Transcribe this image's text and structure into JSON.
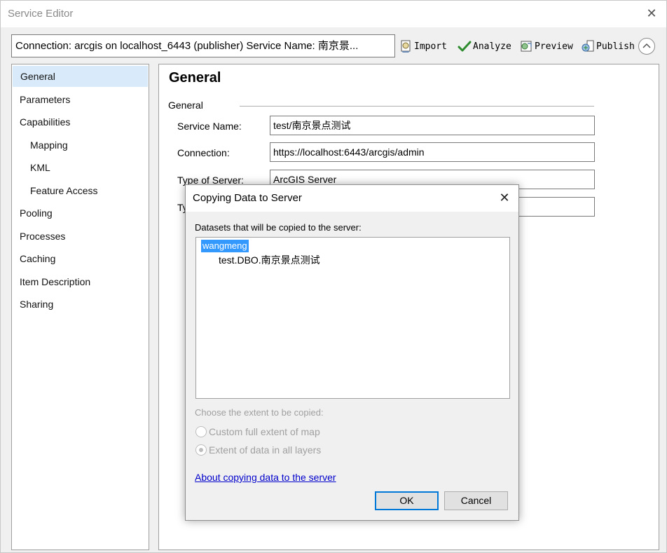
{
  "window": {
    "title": "Service Editor"
  },
  "toolbar": {
    "connection_text": "Connection: arcgis on localhost_6443 (publisher)   Service Name: 南京景...",
    "import_label": "Import",
    "analyze_label": "Analyze",
    "preview_label": "Preview",
    "publish_label": "Publish"
  },
  "sidebar": {
    "items": [
      {
        "label": "General"
      },
      {
        "label": "Parameters"
      },
      {
        "label": "Capabilities"
      },
      {
        "label": "Mapping"
      },
      {
        "label": "KML"
      },
      {
        "label": "Feature Access"
      },
      {
        "label": "Pooling"
      },
      {
        "label": "Processes"
      },
      {
        "label": "Caching"
      },
      {
        "label": "Item Description"
      },
      {
        "label": "Sharing"
      }
    ],
    "selected": "General"
  },
  "main": {
    "heading": "General",
    "group_label": "General",
    "fields": [
      {
        "label": "Service Name:",
        "value": "test/南京景点测试"
      },
      {
        "label": "Connection:",
        "value": "https://localhost:6443/arcgis/admin"
      },
      {
        "label": "Type of Server:",
        "value": "ArcGIS Server"
      },
      {
        "label": "Ty",
        "value": ""
      }
    ]
  },
  "dialog": {
    "title": "Copying Data to Server",
    "datasets_label": "Datasets that will be copied to the server:",
    "tree": {
      "root": "wangmeng",
      "child": "test.DBO.南京景点测试"
    },
    "extent_label": "Choose the extent to be copied:",
    "options": [
      {
        "label": "Custom full extent of map",
        "checked": false
      },
      {
        "label": "Extent of data in all layers",
        "checked": true
      }
    ],
    "link_label": "About copying data to the server",
    "ok_label": "OK",
    "cancel_label": "Cancel"
  },
  "colors": {
    "selection": "#3399ff",
    "sidebar_selected": "#d9ebfa",
    "link": "#0000cc",
    "focus_border": "#0078d7",
    "analyze_check": "#2e8b2e"
  }
}
